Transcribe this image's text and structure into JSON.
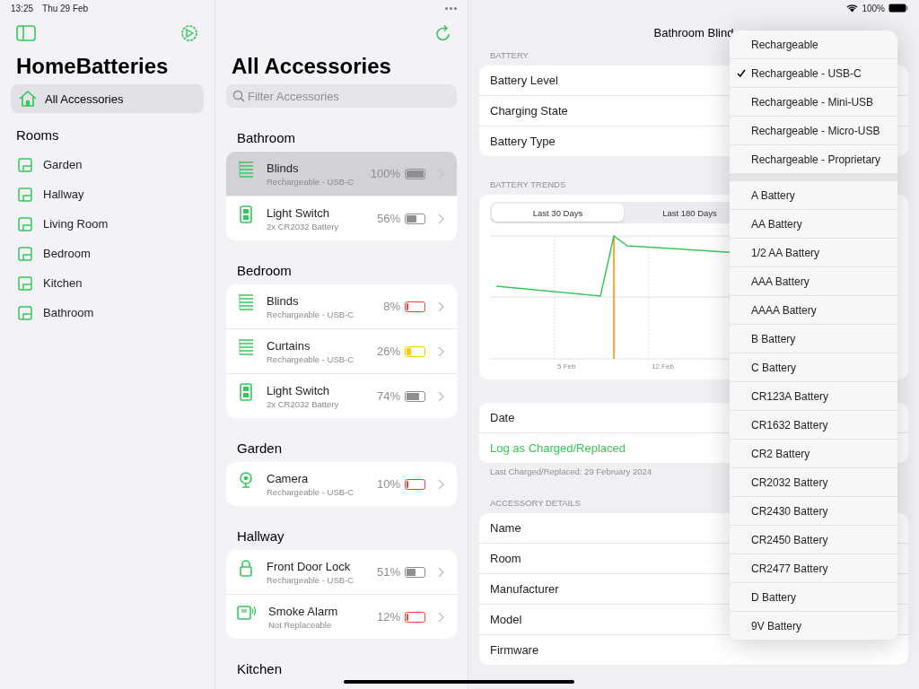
{
  "status_bar": {
    "time": "13:25",
    "date": "Thu 29 Feb",
    "battery_text": "100%"
  },
  "sidebar": {
    "title": "HomeBatteries",
    "items": [
      {
        "label": "All Accessories",
        "selected": true
      }
    ],
    "section": "Rooms",
    "rooms": [
      {
        "label": "Garden",
        "selected": false
      },
      {
        "label": "Hallway",
        "selected": false
      },
      {
        "label": "Living Room",
        "selected": false
      },
      {
        "label": "Bedroom",
        "selected": false
      },
      {
        "label": "Kitchen",
        "selected": false
      },
      {
        "label": "Bathroom",
        "selected": false
      }
    ]
  },
  "list": {
    "title": "All Accessories",
    "search": {
      "placeholder": "Filter Accessories"
    },
    "sections": [
      {
        "title": "Bathroom",
        "items": [
          {
            "kind": "blinds",
            "name": "Blinds",
            "subtitle": "Rechargeable - USB-C",
            "percent": "100%",
            "level": 1,
            "color": "#8e8e93",
            "selected": true
          },
          {
            "kind": "switch",
            "name": "Light Switch",
            "subtitle": "2x CR2032 Battery",
            "percent": "56%",
            "level": 0.56,
            "color": "#8e8e93",
            "selected": false
          }
        ]
      },
      {
        "title": "Bedroom",
        "items": [
          {
            "kind": "blinds",
            "name": "Blinds",
            "subtitle": "Rechargeable - USB-C",
            "percent": "8%",
            "level": 0.08,
            "color": "#ff3b30",
            "selected": false
          },
          {
            "kind": "blinds",
            "name": "Curtains",
            "subtitle": "Rechargeable - USB-C",
            "percent": "26%",
            "level": 0.26,
            "color": "#ffcc00",
            "selected": false
          },
          {
            "kind": "switch",
            "name": "Light Switch",
            "subtitle": "2x CR2032 Battery",
            "percent": "74%",
            "level": 0.74,
            "color": "#8e8e93",
            "selected": false
          }
        ]
      },
      {
        "title": "Garden",
        "items": [
          {
            "kind": "camera",
            "name": "Camera",
            "subtitle": "Rechargeable - USB-C",
            "percent": "10%",
            "level": 0.1,
            "color": "#ff3b30",
            "selected": false
          }
        ]
      },
      {
        "title": "Hallway",
        "items": [
          {
            "kind": "lock",
            "name": "Front Door Lock",
            "subtitle": "Rechargeable - USB-C",
            "percent": "51%",
            "level": 0.51,
            "color": "#8e8e93",
            "selected": false
          },
          {
            "kind": "alarm",
            "name": "Smoke Alarm",
            "subtitle": "Not Replaceable",
            "percent": "12%",
            "level": 0.12,
            "color": "#ff3b30",
            "selected": false
          }
        ]
      },
      {
        "title": "Kitchen"
      }
    ]
  },
  "detail": {
    "title": "Bathroom Blind",
    "battery_header": "BATTERY",
    "battery_rows": [
      "Battery Level",
      "Charging State",
      "Battery Type"
    ],
    "trends_header": "BATTERY TRENDS",
    "segments": [
      {
        "label": "Last 30 Days",
        "selected": true
      },
      {
        "label": "Last 180 Days",
        "selected": false
      }
    ],
    "trend_chart": {
      "x_labels": [
        "5 Feb",
        "12 Feb"
      ]
    },
    "log_rows": [
      {
        "kind": "plain",
        "label": "Date"
      },
      {
        "kind": "action",
        "label": "Log as Charged/Replaced"
      }
    ],
    "log_footer": "Last Charged/Replaced: 29 February 2024",
    "details_header": "ACCESSORY DETAILS",
    "details_rows": [
      "Name",
      "Room",
      "Manufacturer",
      "Model",
      "Firmware"
    ]
  },
  "menu": {
    "groups": [
      [
        {
          "label": "Rechargeable",
          "checked": false
        },
        {
          "label": "Rechargeable - USB-C",
          "checked": true
        },
        {
          "label": "Rechargeable - Mini-USB",
          "checked": false
        },
        {
          "label": "Rechargeable - Micro-USB",
          "checked": false
        },
        {
          "label": "Rechargeable - Proprietary",
          "checked": false
        }
      ],
      [
        {
          "label": "A Battery",
          "checked": false
        },
        {
          "label": "AA Battery",
          "checked": false
        },
        {
          "label": "1/2 AA Battery",
          "checked": false
        },
        {
          "label": "AAA Battery",
          "checked": false
        },
        {
          "label": "AAAA Battery",
          "checked": false
        },
        {
          "label": "B Battery",
          "checked": false
        },
        {
          "label": "C Battery",
          "checked": false
        },
        {
          "label": "CR123A Battery",
          "checked": false
        },
        {
          "label": "CR1632 Battery",
          "checked": false
        },
        {
          "label": "CR2 Battery",
          "checked": false
        },
        {
          "label": "CR2032 Battery",
          "checked": false
        },
        {
          "label": "CR2430 Battery",
          "checked": false
        },
        {
          "label": "CR2450 Battery",
          "checked": false
        },
        {
          "label": "CR2477 Battery",
          "checked": false
        },
        {
          "label": "D Battery",
          "checked": false
        },
        {
          "label": "9V Battery",
          "checked": false
        }
      ]
    ]
  }
}
